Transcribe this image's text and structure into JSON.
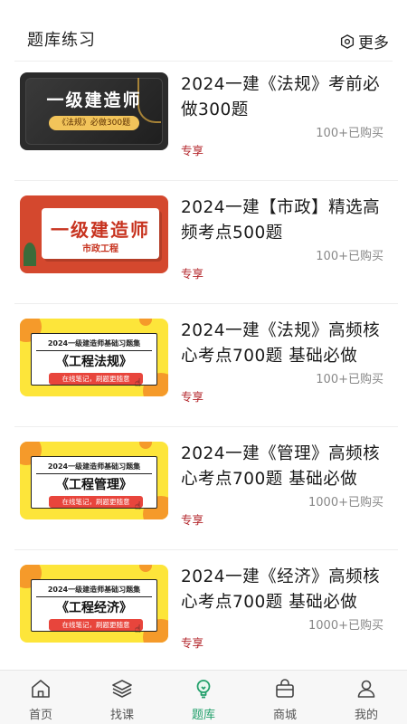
{
  "header": {
    "title": "题库练习",
    "more_label": "更多"
  },
  "items": [
    {
      "title": "2024一建《法规》考前必做300题",
      "buyers": "100+已购买",
      "tag": "专享",
      "thumb": {
        "style": "dark",
        "big": "一级建造师",
        "pill": "《法规》必做300题"
      }
    },
    {
      "title": "2024一建【市政】精选高频考点500题",
      "buyers": "100+已购买",
      "tag": "专享",
      "thumb": {
        "style": "red",
        "big": "一级建造师",
        "sub": "市政工程"
      }
    },
    {
      "title": "2024一建《法规》高频核心考点700题 基础必做",
      "buyers": "100+已购买",
      "tag": "专享",
      "thumb": {
        "style": "yellow",
        "head": "2024一级建造师基础习题集",
        "big": "《工程法规》",
        "pill": "在线笔记，刷题更随意"
      }
    },
    {
      "title": "2024一建《管理》高频核心考点700题 基础必做",
      "buyers": "1000+已购买",
      "tag": "专享",
      "thumb": {
        "style": "yellow",
        "head": "2024一级建造师基础习题集",
        "big": "《工程管理》",
        "pill": "在线笔记，刷题更随意"
      }
    },
    {
      "title": "2024一建《经济》高频核心考点700题 基础必做",
      "buyers": "1000+已购买",
      "tag": "专享",
      "thumb": {
        "style": "yellow",
        "head": "2024一级建造师基础习题集",
        "big": "《工程经济》",
        "pill": "在线笔记，刷题更随意"
      }
    }
  ],
  "tabbar": {
    "tabs": [
      {
        "label": "首页",
        "icon": "home-icon"
      },
      {
        "label": "找课",
        "icon": "layers-icon"
      },
      {
        "label": "题库",
        "icon": "lightbulb-icon",
        "active": true
      },
      {
        "label": "商城",
        "icon": "shop-bag-icon"
      },
      {
        "label": "我的",
        "icon": "user-icon"
      }
    ]
  },
  "colors": {
    "accent": "#22a06b",
    "tag": "#b3262b",
    "muted": "#888888"
  }
}
